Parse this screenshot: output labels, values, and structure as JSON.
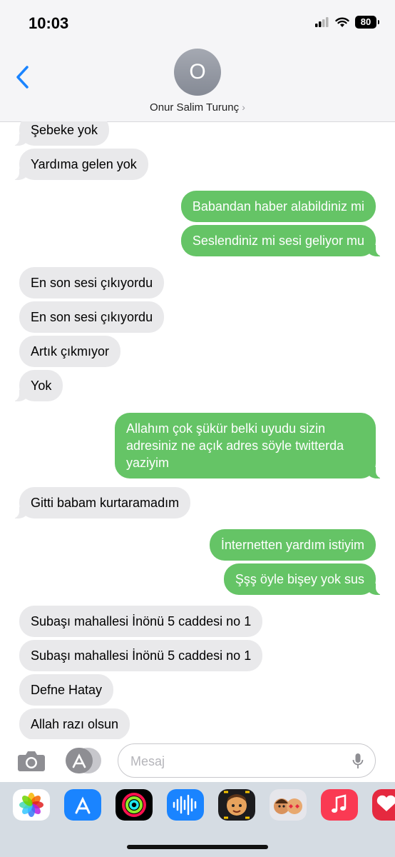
{
  "status": {
    "time": "10:03",
    "battery": "80"
  },
  "header": {
    "avatar_initial": "O",
    "contact_name": "Onur Salim Turunç",
    "chevron": "›"
  },
  "messages": [
    {
      "side": "in",
      "text": "Şebeke yok"
    },
    {
      "side": "in",
      "text": "Yardıma gelen yok"
    },
    {
      "side": "out",
      "text": "Babandan haber alabildiniz mi"
    },
    {
      "side": "out",
      "text": "Seslendiniz mi sesi geliyor mu"
    },
    {
      "side": "in",
      "text": "En son sesi çıkıyordu"
    },
    {
      "side": "in",
      "text": "En son sesi çıkıyordu"
    },
    {
      "side": "in",
      "text": "Artık çıkmıyor"
    },
    {
      "side": "in",
      "text": "Yok"
    },
    {
      "side": "out",
      "text": "Allahım çok şükür belki uyudu sizin adresiniz ne açık adres söyle twitterda yaziyim"
    },
    {
      "side": "in",
      "text": "Gitti babam kurtaramadım"
    },
    {
      "side": "out",
      "text": "İnternetten yardım istiyim"
    },
    {
      "side": "out",
      "text": "Şşş öyle bişey yok sus"
    },
    {
      "side": "in",
      "text": "Subaşı mahallesi İnönü 5 caddesi no 1"
    },
    {
      "side": "in",
      "text": "Subaşı mahallesi İnönü 5 caddesi no 1"
    },
    {
      "side": "in",
      "text": "Defne Hatay"
    },
    {
      "side": "in",
      "text": "Allah razı olsun"
    }
  ],
  "input": {
    "placeholder": "Mesaj"
  },
  "colors": {
    "outgoing": "#65c466",
    "incoming": "#e9e9eb",
    "accent": "#1a84ff"
  },
  "app_strip": [
    "photos-icon",
    "app-store-icon",
    "activity-icon",
    "audio-message-icon",
    "memoji-icon",
    "memoji-stickers-icon",
    "music-icon",
    "digital-touch-icon"
  ]
}
